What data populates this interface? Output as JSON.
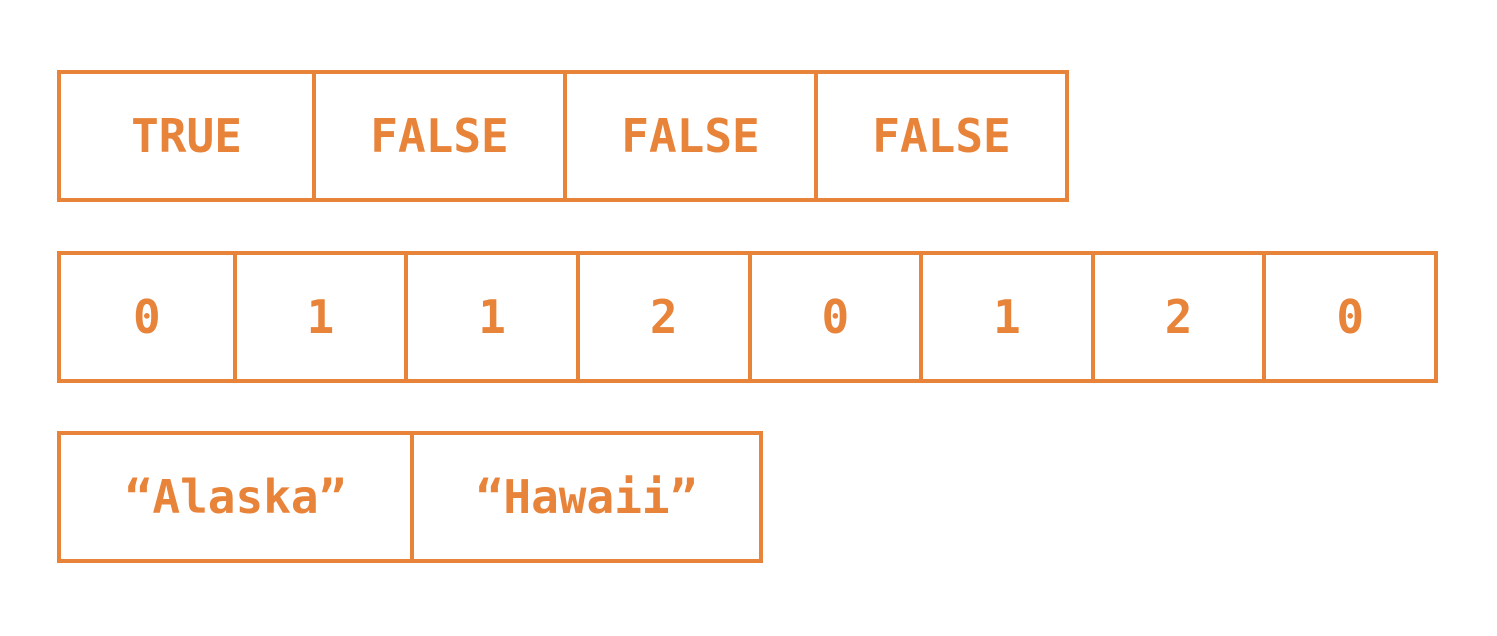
{
  "accent_color": "#E8833A",
  "vectors": {
    "logical": [
      "TRUE",
      "FALSE",
      "FALSE",
      "FALSE"
    ],
    "integer": [
      "0",
      "1",
      "1",
      "2",
      "0",
      "1",
      "2",
      "0"
    ],
    "character": [
      "“Alaska”",
      "“Hawaii”"
    ]
  }
}
